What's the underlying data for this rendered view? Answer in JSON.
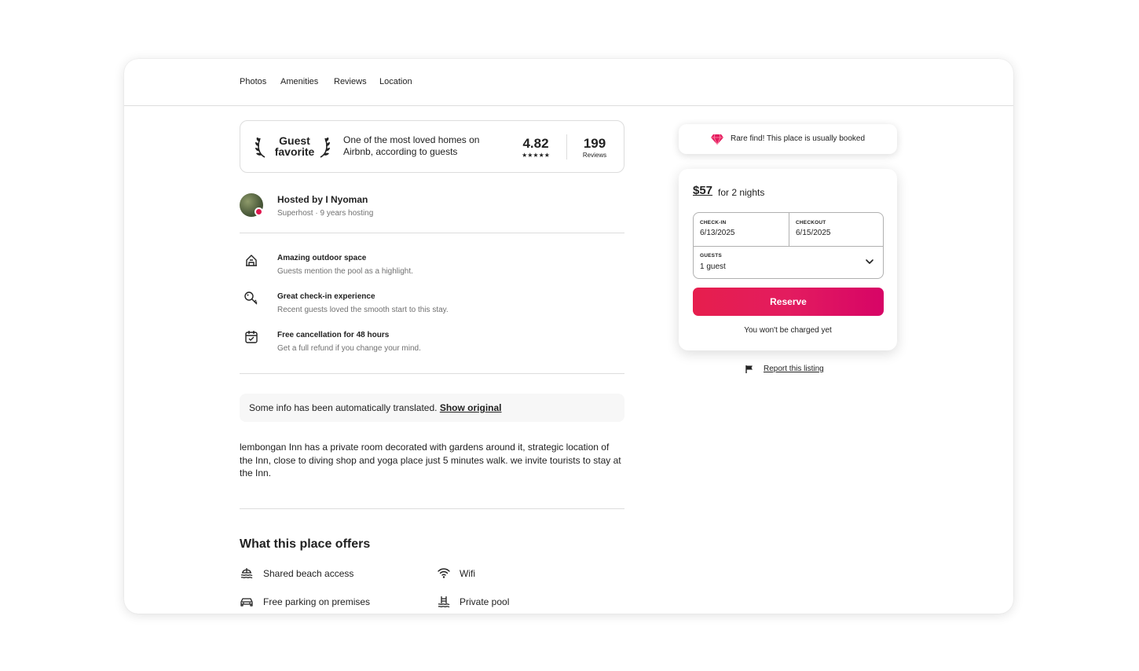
{
  "nav": {
    "tabs": [
      "Photos",
      "Amenities",
      "Reviews",
      "Location"
    ]
  },
  "guest_favorite": {
    "title_line1": "Guest",
    "title_line2": "favorite",
    "description": "One of the most loved homes on Airbnb, according to guests",
    "rating": "4.82",
    "stars": "★★★★★",
    "review_count": "199",
    "reviews_label": "Reviews"
  },
  "host": {
    "name": "Hosted by I Nyoman",
    "subtitle": "Superhost · 9 years hosting"
  },
  "highlights": [
    {
      "icon": "outdoor-space-icon",
      "title": "Amazing outdoor space",
      "subtitle": "Guests mention the pool as a highlight."
    },
    {
      "icon": "key-icon",
      "title": "Great check-in experience",
      "subtitle": "Recent guests loved the smooth start to this stay."
    },
    {
      "icon": "calendar-icon",
      "title": "Free cancellation for 48 hours",
      "subtitle": "Get a full refund if you change your mind."
    }
  ],
  "translation": {
    "text": "Some info has been automatically translated.",
    "link": "Show original"
  },
  "description": "lembongan Inn has a private room decorated with gardens around it, strategic location of the Inn, close to diving shop and yoga place just 5 minutes walk. we invite tourists to stay at the Inn.",
  "offers": {
    "title": "What this place offers",
    "items": [
      {
        "icon": "beach-icon",
        "label": "Shared beach access"
      },
      {
        "icon": "wifi-icon",
        "label": "Wifi"
      },
      {
        "icon": "car-icon",
        "label": "Free parking on premises"
      },
      {
        "icon": "pool-icon",
        "label": "Private pool"
      }
    ]
  },
  "rare_find": {
    "text": "Rare find! This place is usually booked"
  },
  "booking": {
    "price": "$57",
    "nights": "for 2 nights",
    "checkin_label": "CHECK-IN",
    "checkin_value": "6/13/2025",
    "checkout_label": "CHECKOUT",
    "checkout_value": "6/15/2025",
    "guests_label": "GUESTS",
    "guests_value": "1 guest",
    "reserve_label": "Reserve",
    "note": "You won't be charged yet"
  },
  "report": {
    "label": "Report this listing"
  },
  "colors": {
    "accent": "#e31c5f",
    "text": "#222222",
    "muted": "#717171",
    "border": "#dddddd"
  }
}
